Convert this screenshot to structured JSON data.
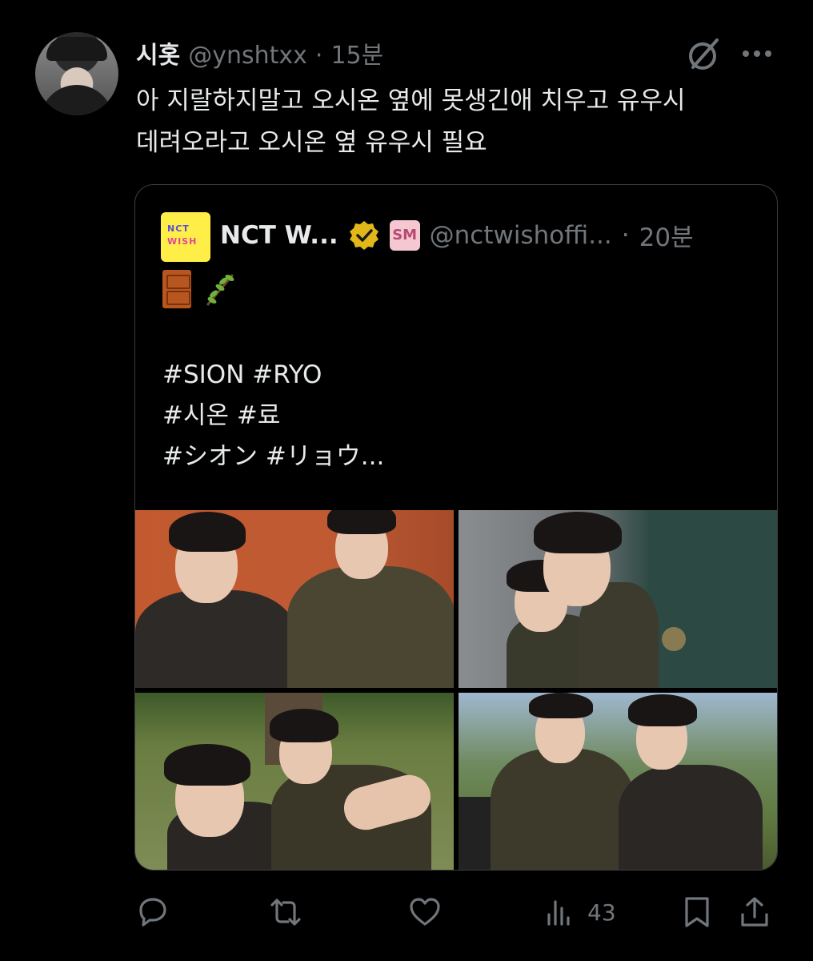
{
  "tweet": {
    "display_name": "시홋",
    "handle": "@ynshtxx",
    "separator": "·",
    "time": "15분",
    "text_lines": [
      "아 지랄하지말고 오시온 옆에 못생긴애 치우고 유우시",
      "데려오라고 오시온 옆 유우시 필요"
    ]
  },
  "quote": {
    "display_name": "NCT W...",
    "handle": "@nctwishoffi...",
    "separator": "·",
    "time": "20분",
    "avatar_text": [
      "NCT",
      "WISH"
    ],
    "affiliate_badge": "SM",
    "emoji_icons": [
      "door-icon",
      "herb-icon"
    ],
    "hashtag_lines": [
      "#SION #RYO",
      "#시온 #료",
      "#シオン #リョウ..."
    ],
    "photos": [
      {
        "name": "photo-orange-wall"
      },
      {
        "name": "photo-green-door"
      },
      {
        "name": "photo-lawn-selfie"
      },
      {
        "name": "photo-outdoor-duo"
      }
    ]
  },
  "actions": {
    "reply_icon": "reply-icon",
    "retweet_icon": "retweet-icon",
    "like_icon": "heart-icon",
    "views_icon": "views-icon",
    "views_count": "43",
    "bookmark_icon": "bookmark-icon",
    "share_icon": "share-icon"
  },
  "colors": {
    "background": "#000000",
    "text": "#e7e9ea",
    "secondary": "#71767b",
    "verified_gold": "#e2b719",
    "border": "#3b3f44"
  }
}
